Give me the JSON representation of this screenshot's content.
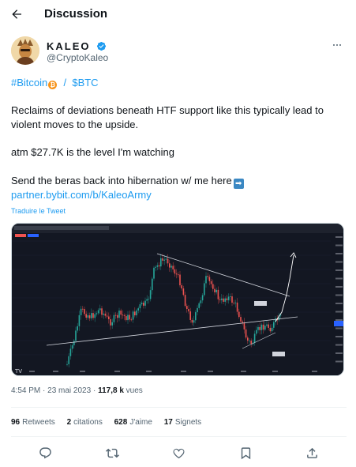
{
  "header": {
    "title": "Discussion"
  },
  "author": {
    "name": "KALEO",
    "handle": "@CryptoKaleo"
  },
  "tweet": {
    "line1_hashtag": "#Bitcoin",
    "line1_sep": "/",
    "line1_cashtag": "$BTC",
    "line2": "Reclaims of deviations beneath HTF support like this typically lead to",
    "line3": "violent moves to the upside.",
    "line4": "atm $27.7K is the level I'm watching",
    "line5": "Send the beras back into hibernation w/ me here",
    "link": "partner.bybit.com/b/KaleoArmy"
  },
  "translate_label": "Traduire le Tweet",
  "meta": {
    "time": "4:54 PM",
    "date": "23 mai 2023",
    "views_count": "117,8 k",
    "views_label": "vues"
  },
  "stats": [
    {
      "count": "96",
      "label": "Retweets"
    },
    {
      "count": "2",
      "label": "citations"
    },
    {
      "count": "628",
      "label": "J'aime"
    },
    {
      "count": "17",
      "label": "Signets"
    }
  ],
  "icons": {
    "back": "arrow-left-icon",
    "verified": "verified-badge-icon",
    "more": "more-icon",
    "reply": "reply-icon",
    "retweet": "retweet-icon",
    "like": "heart-icon",
    "bookmark": "bookmark-icon",
    "share": "share-icon"
  },
  "colors": {
    "accent": "#1d9bf0",
    "text": "#0f1419",
    "secondary": "#536471",
    "chart_bg": "#131722",
    "candle_up": "#26a69a",
    "candle_down": "#ef5350"
  }
}
